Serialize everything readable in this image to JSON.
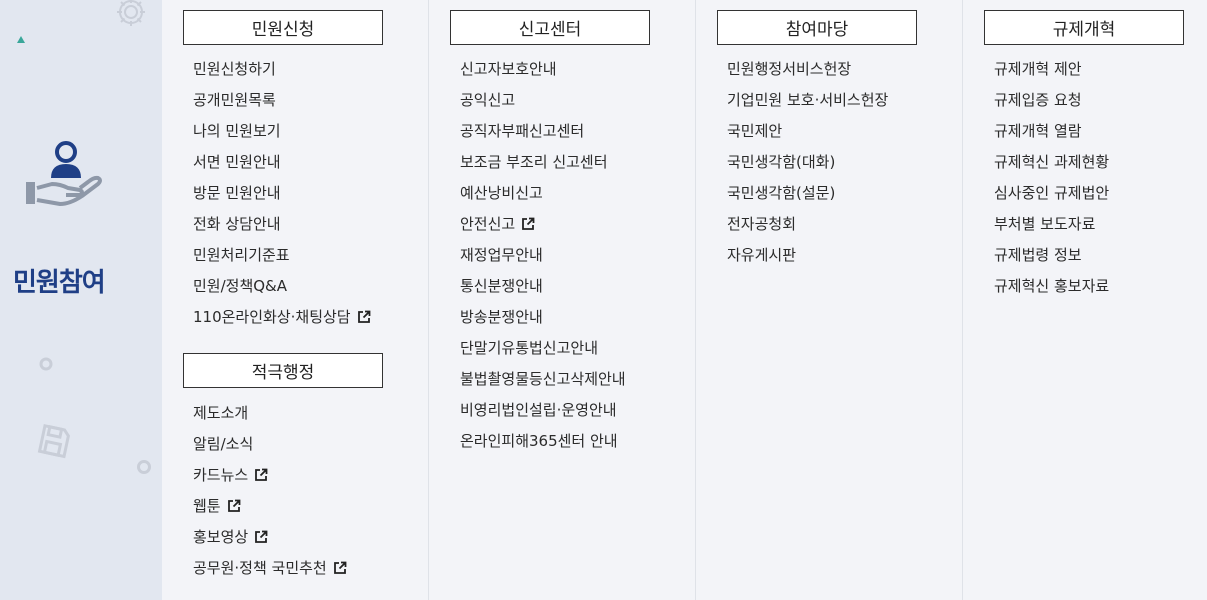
{
  "sidebar": {
    "title": "민원참여"
  },
  "columns": [
    {
      "sections": [
        {
          "title": "민원신청",
          "items": [
            {
              "label": "민원신청하기"
            },
            {
              "label": "공개민원목록"
            },
            {
              "label": "나의 민원보기"
            },
            {
              "label": "서면 민원안내"
            },
            {
              "label": "방문 민원안내"
            },
            {
              "label": "전화 상담안내"
            },
            {
              "label": "민원처리기준표"
            },
            {
              "label": "민원/정책Q&A"
            },
            {
              "label": "110온라인화상·채팅상담",
              "icon": "external-link-icon"
            }
          ]
        },
        {
          "title": "적극행정",
          "items": [
            {
              "label": "제도소개"
            },
            {
              "label": "알림/소식"
            },
            {
              "label": "카드뉴스",
              "icon": "external-link-icon"
            },
            {
              "label": "웹툰",
              "icon": "external-link-icon"
            },
            {
              "label": "홍보영상",
              "icon": "external-link-icon"
            },
            {
              "label": "공무원·정책 국민추천",
              "icon": "external-link-icon"
            }
          ]
        }
      ]
    },
    {
      "sections": [
        {
          "title": "신고센터",
          "items": [
            {
              "label": "신고자보호안내"
            },
            {
              "label": "공익신고"
            },
            {
              "label": "공직자부패신고센터"
            },
            {
              "label": "보조금 부조리 신고센터"
            },
            {
              "label": "예산낭비신고"
            },
            {
              "label": "안전신고",
              "icon": "external-link-icon"
            },
            {
              "label": "재정업무안내"
            },
            {
              "label": "통신분쟁안내"
            },
            {
              "label": "방송분쟁안내"
            },
            {
              "label": "단말기유통법신고안내"
            },
            {
              "label": "불법촬영물등신고삭제안내"
            },
            {
              "label": "비영리법인설립·운영안내"
            },
            {
              "label": "온라인피해365센터 안내"
            }
          ]
        }
      ]
    },
    {
      "sections": [
        {
          "title": "참여마당",
          "items": [
            {
              "label": "민원행정서비스헌장"
            },
            {
              "label": "기업민원 보호·서비스헌장"
            },
            {
              "label": "국민제안"
            },
            {
              "label": "국민생각함(대화)"
            },
            {
              "label": "국민생각함(설문)"
            },
            {
              "label": "전자공청회"
            },
            {
              "label": "자유게시판"
            }
          ]
        }
      ]
    },
    {
      "sections": [
        {
          "title": "규제개혁",
          "items": [
            {
              "label": "규제개혁 제안"
            },
            {
              "label": "규제입증 요청"
            },
            {
              "label": "규제개혁 열람"
            },
            {
              "label": "규제혁신 과제현황"
            },
            {
              "label": "심사중인 규제법안"
            },
            {
              "label": "부처별 보도자료"
            },
            {
              "label": "규제법령 정보"
            },
            {
              "label": "규제혁신 홍보자료"
            }
          ]
        }
      ]
    }
  ],
  "colors": {
    "sidebar_bg": "#e2e7f0",
    "title_blue": "#1f3f86",
    "page_bg": "#f3f4f8"
  }
}
